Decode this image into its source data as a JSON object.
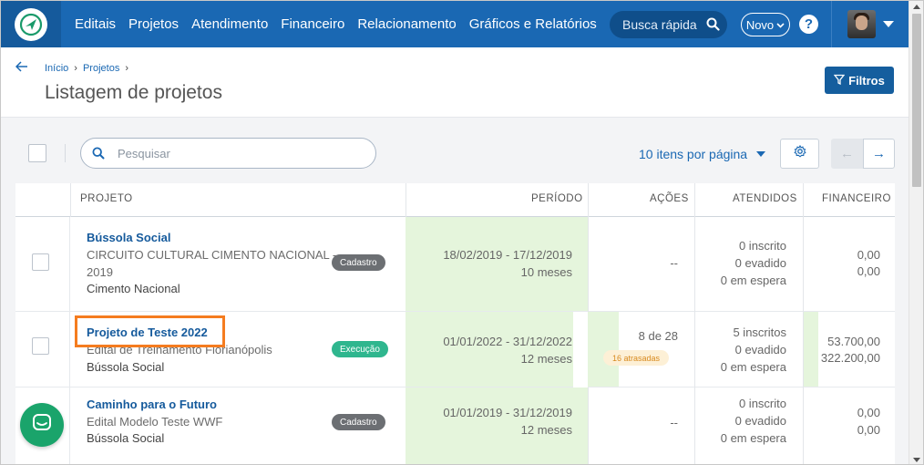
{
  "nav": {
    "menu": [
      "Editais",
      "Projetos",
      "Atendimento",
      "Financeiro",
      "Relacionamento",
      "Gráficos e Relatórios"
    ],
    "search_label": "Busca rápida",
    "novo_label": "Novo",
    "help_label": "?"
  },
  "header": {
    "breadcrumb": [
      "Início",
      "Projetos"
    ],
    "title": "Listagem de projetos",
    "filtros_label": "Filtros"
  },
  "toolbar": {
    "search_placeholder": "Pesquisar",
    "per_page": "10 itens por página"
  },
  "table": {
    "columns": [
      "PROJETO",
      "PERÍODO",
      "AÇÕES",
      "ATENDIDOS",
      "FINANCEIRO"
    ],
    "rows": [
      {
        "name": "Bússola Social",
        "edital_line1": "CIRCUITO CULTURAL CIMENTO NACIONAL -",
        "edital_line2": "2019",
        "org": "Cimento Nacional",
        "status": "Cadastro",
        "period": "18/02/2019 - 17/12/2019",
        "duration": "10 meses",
        "acoes": "--",
        "inscritos": "0 inscrito",
        "evadidos": "0 evadido",
        "espera": "0 em espera",
        "fin1": "0,00",
        "fin2": "0,00"
      },
      {
        "name": "Projeto de Teste 2022",
        "edital_line1": "Edital de Treinamento Florianópolis",
        "org": "Bússola Social",
        "status": "Execução",
        "period": "01/01/2022 - 31/12/2022",
        "duration": "12 meses",
        "acoes": "8 de 28",
        "acoes_late": "16 atrasadas",
        "inscritos": "5 inscritos",
        "evadidos": "0 evadido",
        "espera": "0 em espera",
        "fin1": "53.700,00",
        "fin2": "322.200,00"
      },
      {
        "name": "Caminho para o Futuro",
        "edital_line1": "Edital Modelo Teste WWF",
        "org": "Bússola Social",
        "status": "Cadastro",
        "period": "01/01/2019 - 31/12/2019",
        "duration": "12 meses",
        "acoes": "--",
        "inscritos": "0 inscrito",
        "evadidos": "0 evadido",
        "espera": "0 em espera",
        "fin1": "0,00",
        "fin2": "0,00"
      }
    ]
  },
  "colors": {
    "nav_bg": "#1a68b3",
    "period_bg": "#e5f5dc",
    "highlight": "#f57c1f",
    "chat": "#1aa46b"
  },
  "icons": [
    "logo-icon",
    "search-icon",
    "chevron-down-icon",
    "help-icon",
    "back-arrow-icon",
    "filter-icon",
    "gear-icon",
    "arrow-left-icon",
    "arrow-right-icon",
    "chat-icon"
  ]
}
